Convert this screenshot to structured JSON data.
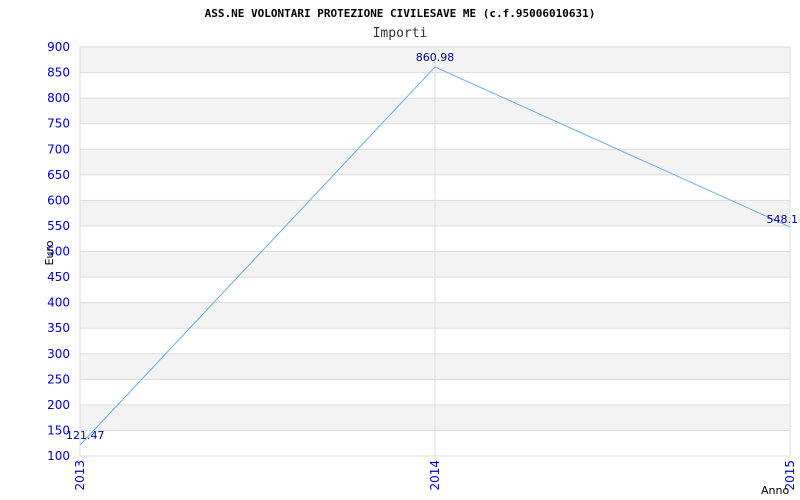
{
  "chart_data": {
    "type": "line",
    "title": "ASS.NE VOLONTARI PROTEZIONE CIVILESAVE ME (c.f.95006010631)",
    "subtitle": "Importi",
    "xlabel": "Anno",
    "ylabel": "Euro",
    "x": [
      "2013",
      "2014",
      "2015"
    ],
    "series": [
      {
        "values": [
          121.47,
          860.98,
          548.1
        ]
      }
    ],
    "data_labels": [
      "121.47",
      "860.98",
      "548.1"
    ],
    "ylim": [
      100,
      900
    ],
    "yticks": [
      100,
      150,
      200,
      250,
      300,
      350,
      400,
      450,
      500,
      550,
      600,
      650,
      700,
      750,
      800,
      850,
      900
    ],
    "grid": true,
    "line_color": "#6aaee8",
    "band_color": "#f3f3f3",
    "tick_color": "#0000cc"
  }
}
